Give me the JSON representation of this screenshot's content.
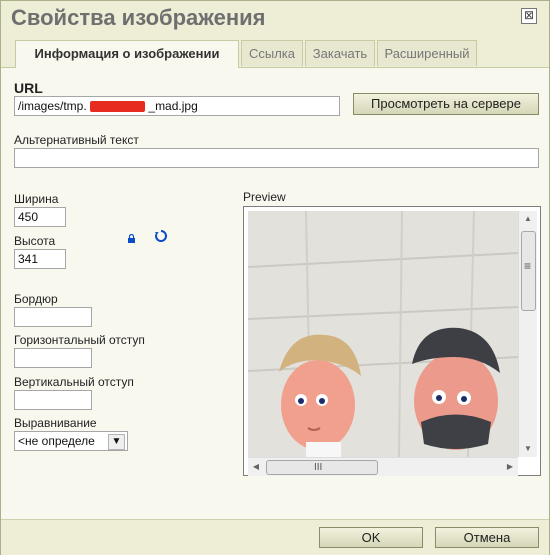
{
  "dialog": {
    "title": "Свойства изображения",
    "close_label": "⊠"
  },
  "tabs": [
    {
      "label": "Информация о изображении"
    },
    {
      "label": "Ссылка"
    },
    {
      "label": "Закачать"
    },
    {
      "label": "Расширенный"
    }
  ],
  "form": {
    "url_label": "URL",
    "url_value_prefix": "/images/tmp.",
    "url_value_suffix": "_mad.jpg",
    "browse_server": "Просмотреть на сервере",
    "alt_label": "Альтернативный текст",
    "alt_value": "",
    "width_label": "Ширина",
    "width_value": "450",
    "height_label": "Высота",
    "height_value": "341",
    "border_label": "Бордюр",
    "hspace_label": "Горизонтальный отступ",
    "vspace_label": "Вертикальный отступ",
    "align_label": "Выравнивание",
    "align_value": "<не определе"
  },
  "preview": {
    "label": "Preview",
    "hscroll_glyph": "III",
    "vscroll_glyph": "≡",
    "arrow_up": "▲",
    "arrow_down": "▼",
    "arrow_left": "◀",
    "arrow_right": "▶"
  },
  "footer": {
    "ok": "OK",
    "cancel": "Отмена"
  },
  "colors": {
    "accent": "#c9c9a4",
    "redaction": "#e62b1f"
  }
}
